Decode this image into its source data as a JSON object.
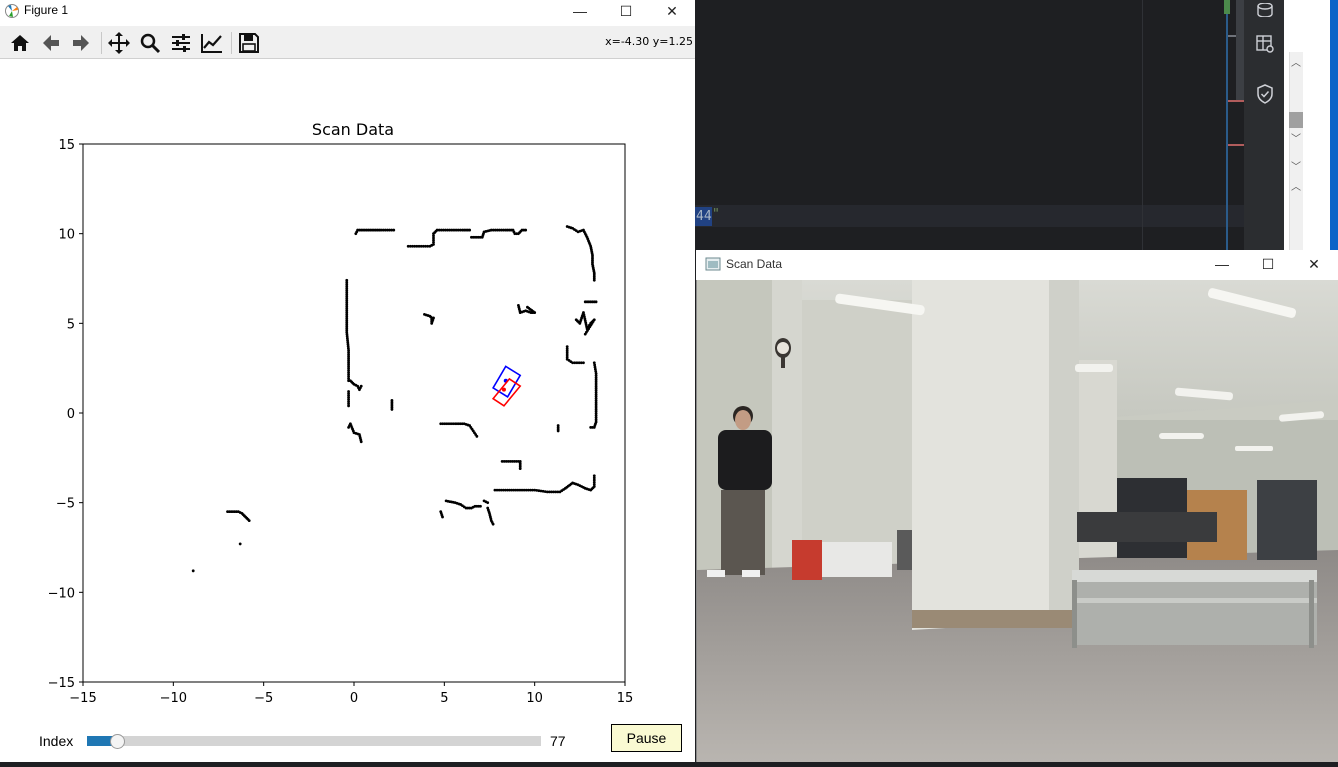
{
  "figure_window": {
    "title": "Figure 1",
    "controls": {
      "minimize": "—",
      "maximize": "☐",
      "close": "✕"
    },
    "toolbar": {
      "items": [
        "home-icon",
        "back-arrow-icon",
        "forward-arrow-icon",
        "pan-move-icon",
        "zoom-magnifier-icon",
        "configure-subplots-icon",
        "edit-axis-icon",
        "save-disk-icon"
      ],
      "coordinate_readout": "x=-4.30 y=1.25"
    },
    "controls_bar": {
      "slider_label": "Index",
      "slider_value": "77",
      "slider_fraction": 0.065,
      "pause_label": "Pause"
    }
  },
  "chart_data": {
    "type": "scatter",
    "title": "Scan Data",
    "xlabel": "",
    "ylabel": "",
    "xlim": [
      -15,
      15
    ],
    "ylim": [
      -15,
      15
    ],
    "xticks": [
      -15,
      -10,
      -5,
      0,
      5,
      10,
      15
    ],
    "yticks": [
      -15,
      -10,
      -5,
      0,
      5,
      10,
      15
    ],
    "grid": false,
    "point_color": "#000000",
    "walls": [
      [
        [
          0.1,
          10.0
        ],
        [
          0.2,
          10.2
        ],
        [
          0.5,
          10.2
        ],
        [
          1.0,
          10.2
        ],
        [
          1.5,
          10.2
        ],
        [
          2.2,
          10.2
        ]
      ],
      [
        [
          3.0,
          9.3
        ],
        [
          3.6,
          9.3
        ],
        [
          4.2,
          9.3
        ],
        [
          4.4,
          9.4
        ],
        [
          4.4,
          10.0
        ],
        [
          4.6,
          10.2
        ],
        [
          5.3,
          10.2
        ],
        [
          6.0,
          10.2
        ],
        [
          6.4,
          10.2
        ]
      ],
      [
        [
          6.5,
          9.8
        ],
        [
          6.9,
          9.8
        ],
        [
          7.1,
          9.8
        ],
        [
          7.2,
          10.1
        ],
        [
          7.6,
          10.2
        ],
        [
          8.4,
          10.2
        ],
        [
          8.8,
          10.2
        ],
        [
          8.9,
          10.0
        ],
        [
          9.1,
          10.0
        ],
        [
          9.3,
          10.2
        ],
        [
          9.5,
          10.2
        ]
      ],
      [
        [
          11.8,
          10.4
        ],
        [
          12.1,
          10.3
        ],
        [
          12.4,
          10.1
        ],
        [
          12.7,
          10.2
        ],
        [
          12.9,
          9.8
        ],
        [
          13.1,
          9.3
        ],
        [
          13.2,
          8.8
        ],
        [
          13.2,
          8.3
        ],
        [
          13.3,
          7.8
        ],
        [
          13.3,
          7.4
        ]
      ],
      [
        [
          -0.4,
          7.4
        ],
        [
          -0.4,
          6.5
        ],
        [
          -0.4,
          5.5
        ],
        [
          -0.4,
          4.5
        ],
        [
          -0.3,
          3.5
        ],
        [
          -0.3,
          2.5
        ],
        [
          -0.3,
          1.8
        ]
      ],
      [
        [
          -0.2,
          1.8
        ],
        [
          0.0,
          1.6
        ],
        [
          0.2,
          1.5
        ],
        [
          0.3,
          1.3
        ],
        [
          0.4,
          1.5
        ]
      ],
      [
        [
          -0.3,
          1.2
        ],
        [
          -0.3,
          0.4
        ]
      ],
      [
        [
          2.1,
          0.7
        ],
        [
          2.1,
          0.2
        ]
      ],
      [
        [
          3.9,
          5.5
        ],
        [
          4.2,
          5.4
        ],
        [
          4.3,
          5.3
        ],
        [
          4.3,
          5.0
        ],
        [
          4.4,
          5.3
        ]
      ],
      [
        [
          9.1,
          6.0
        ],
        [
          9.2,
          5.6
        ],
        [
          9.5,
          5.7
        ],
        [
          9.8,
          5.6
        ],
        [
          10.0,
          5.6
        ],
        [
          9.6,
          5.9
        ]
      ],
      [
        [
          12.8,
          6.2
        ],
        [
          13.2,
          6.2
        ],
        [
          13.4,
          6.2
        ]
      ],
      [
        [
          12.3,
          5.2
        ],
        [
          12.5,
          5.0
        ],
        [
          12.7,
          5.6
        ],
        [
          12.9,
          4.7
        ],
        [
          13.1,
          5.0
        ],
        [
          13.3,
          5.2
        ],
        [
          12.8,
          4.4
        ]
      ],
      [
        [
          11.8,
          3.7
        ],
        [
          11.8,
          3.0
        ],
        [
          12.1,
          2.8
        ],
        [
          12.7,
          2.8
        ]
      ],
      [
        [
          13.3,
          2.8
        ],
        [
          13.4,
          2.2
        ],
        [
          13.4,
          1.5
        ],
        [
          13.4,
          0.8
        ],
        [
          13.4,
          0.1
        ],
        [
          13.4,
          -0.5
        ],
        [
          13.3,
          -0.8
        ],
        [
          13.1,
          -0.8
        ]
      ],
      [
        [
          -0.3,
          -0.8
        ],
        [
          -0.2,
          -0.6
        ],
        [
          0.0,
          -1.1
        ],
        [
          0.3,
          -1.2
        ],
        [
          0.4,
          -1.6
        ]
      ],
      [
        [
          4.8,
          -0.6
        ],
        [
          5.6,
          -0.6
        ],
        [
          6.1,
          -0.6
        ],
        [
          6.4,
          -0.7
        ],
        [
          6.6,
          -1.0
        ],
        [
          6.8,
          -1.3
        ]
      ],
      [
        [
          11.3,
          -0.7
        ],
        [
          11.3,
          -1.0
        ]
      ],
      [
        [
          8.2,
          -2.7
        ],
        [
          9.2,
          -2.7
        ],
        [
          9.2,
          -3.1
        ]
      ],
      [
        [
          7.8,
          -4.3
        ],
        [
          8.5,
          -4.3
        ],
        [
          9.3,
          -4.3
        ],
        [
          10.0,
          -4.3
        ],
        [
          10.7,
          -4.4
        ],
        [
          11.4,
          -4.4
        ],
        [
          11.7,
          -4.2
        ],
        [
          12.1,
          -3.9
        ],
        [
          12.4,
          -4.0
        ],
        [
          12.8,
          -4.2
        ],
        [
          13.1,
          -4.3
        ],
        [
          13.3,
          -4.1
        ],
        [
          13.3,
          -3.5
        ]
      ],
      [
        [
          5.1,
          -4.9
        ],
        [
          5.6,
          -5.0
        ],
        [
          5.9,
          -5.1
        ],
        [
          6.2,
          -5.3
        ],
        [
          6.5,
          -5.3
        ],
        [
          6.7,
          -5.2
        ],
        [
          7.0,
          -5.2
        ]
      ],
      [
        [
          4.8,
          -5.5
        ],
        [
          4.9,
          -5.8
        ]
      ],
      [
        [
          7.4,
          -5.3
        ],
        [
          7.5,
          -5.6
        ],
        [
          7.6,
          -6.0
        ],
        [
          7.7,
          -6.2
        ]
      ],
      [
        [
          7.2,
          -4.9
        ],
        [
          7.4,
          -5.0
        ]
      ],
      [
        [
          -7.0,
          -5.5
        ],
        [
          -6.7,
          -5.5
        ],
        [
          -6.4,
          -5.5
        ],
        [
          -6.2,
          -5.6
        ],
        [
          -6.0,
          -5.8
        ],
        [
          -5.8,
          -6.0
        ]
      ],
      [
        [
          -6.3,
          -7.3
        ]
      ],
      [
        [
          -8.9,
          -8.8
        ]
      ]
    ],
    "boxes": [
      {
        "color": "#0000ff",
        "corners": [
          [
            8.4,
            2.6
          ],
          [
            9.2,
            2.1
          ],
          [
            8.5,
            0.9
          ],
          [
            7.7,
            1.4
          ]
        ],
        "marker": [
          8.4,
          1.8
        ]
      },
      {
        "color": "#ff0000",
        "corners": [
          [
            8.6,
            1.9
          ],
          [
            9.2,
            1.5
          ],
          [
            8.3,
            0.4
          ],
          [
            7.7,
            0.8
          ]
        ],
        "marker": [
          8.3,
          1.3
        ]
      }
    ]
  },
  "ide": {
    "code_fragment": "44",
    "code_quote": "\"",
    "sidebar_icons": [
      "database-icon",
      "table-search-icon",
      "shield-check-icon"
    ]
  },
  "camera_window": {
    "title": "Scan Data",
    "controls": {
      "minimize": "—",
      "maximize": "☐",
      "close": "✕"
    }
  },
  "colors": {
    "accent": "#1f77b4",
    "pause_bg": "#fafad2"
  }
}
